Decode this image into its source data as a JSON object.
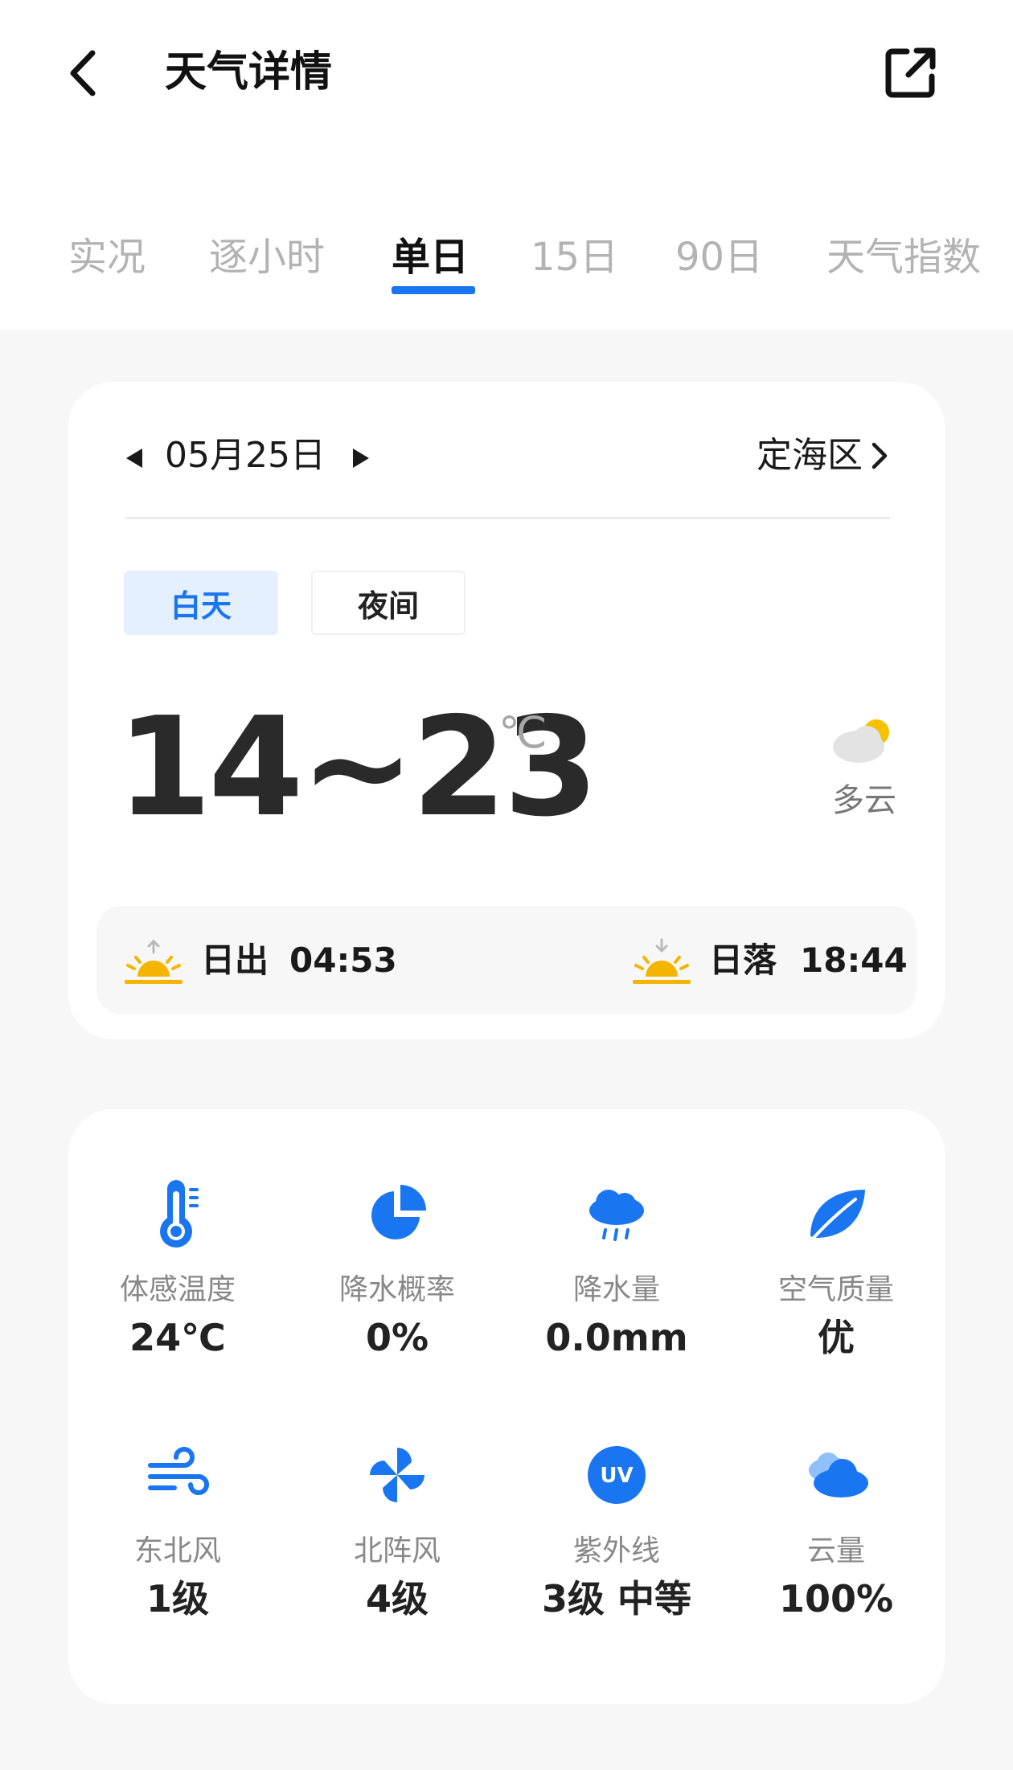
{
  "header": {
    "title": "天气详情"
  },
  "tabs": [
    {
      "label": "实况",
      "active": false
    },
    {
      "label": "逐小时",
      "active": false
    },
    {
      "label": "单日",
      "active": true
    },
    {
      "label": "15日",
      "active": false
    },
    {
      "label": "90日",
      "active": false
    },
    {
      "label": "天气指数",
      "active": false
    }
  ],
  "day_card": {
    "date": "05月25日",
    "location": "定海区",
    "segments": {
      "day": "白天",
      "night": "夜间"
    },
    "selected_segment": "day",
    "temp_range": "14~23",
    "temp_unit": "℃",
    "condition": "多云",
    "condition_icon": "partly-cloudy-icon",
    "sunrise": {
      "label": "日出",
      "time": "04:53"
    },
    "sunset": {
      "label": "日落",
      "time": "18:44"
    }
  },
  "metrics": [
    {
      "icon": "thermometer-icon",
      "label": "体感温度",
      "value": "24℃"
    },
    {
      "icon": "pie-chart-icon",
      "label": "降水概率",
      "value": "0%"
    },
    {
      "icon": "rain-cloud-icon",
      "label": "降水量",
      "value": "0.0mm"
    },
    {
      "icon": "leaf-icon",
      "label": "空气质量",
      "value": "优"
    },
    {
      "icon": "wind-icon",
      "label": "东北风",
      "value": "1级"
    },
    {
      "icon": "pinwheel-icon",
      "label": "北阵风",
      "value": "4级"
    },
    {
      "icon": "uv-icon",
      "uv_text": "UV",
      "label": "紫外线",
      "value": "3级 中等"
    },
    {
      "icon": "cloud-icon",
      "label": "云量",
      "value": "100%"
    }
  ],
  "colors": {
    "accent": "#1a76f0",
    "icon_blue": "#1a76f0",
    "sun_yellow": "#f5b400",
    "background": "#f7f7f7"
  }
}
